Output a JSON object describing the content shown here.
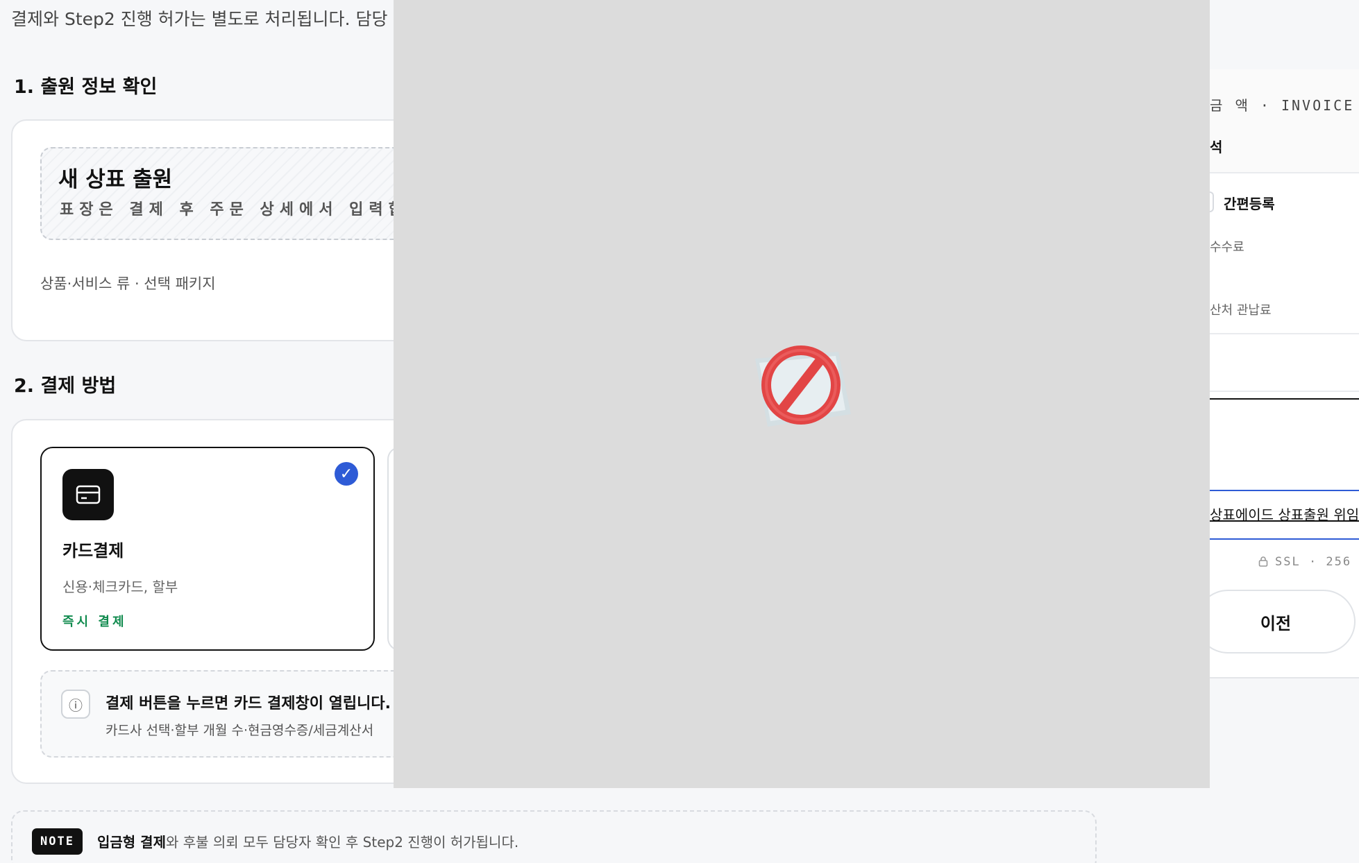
{
  "top_note": "결제와 Step2 진행 허가는 별도로 처리됩니다. 담당",
  "section1": {
    "title": "1. 출원 정보 확인",
    "new_title": "새 상표 출원",
    "new_sub": "표장은 결제 후 주문 상세에서 입력합니다",
    "class_line": "상품·서비스 류 · 선택 패키지"
  },
  "section2": {
    "title": "2. 결제 방법",
    "card": {
      "check": "✓",
      "name": "카드결제",
      "desc": "신용·체크카드, 할부",
      "tag": "즉시 결제"
    },
    "info": {
      "icon": "ⓘ",
      "title": "결제 버튼을 누르면 카드 결제창이 열립니다.",
      "sub": "카드사 선택·할부 개월 수·현금영수증/세금계산서"
    }
  },
  "note": {
    "badge": "NOTE",
    "bold": "입금형 결제",
    "text": "와 후불 의뢰 모두 담당자 확인 후 Step2 진행이 허가됩니다."
  },
  "right_panel": {
    "invoice": "금 액 · INVOICE",
    "head2": "석",
    "simple": "간편등록",
    "fee1": "수수료",
    "fee2": "산처 관납료",
    "link": "상표에이드 상표출원 위임",
    "ssl": "SSL · 256",
    "prev": "이전"
  },
  "colors": {
    "accent": "#2e5bd6",
    "green": "#0f8a4d",
    "overlay": "#dcdcdc"
  }
}
